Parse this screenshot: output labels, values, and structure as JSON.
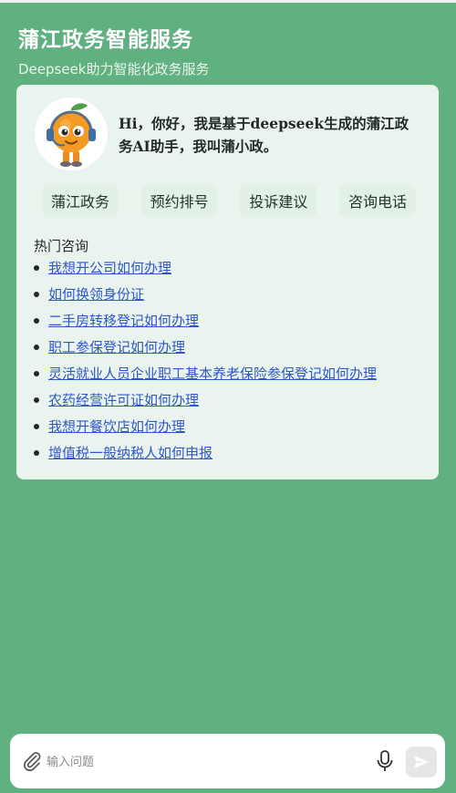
{
  "app": {
    "title": "蒲江政务智能服务",
    "subtitle": "Deepseek助力智能化政务服务"
  },
  "assistant": {
    "greeting": "Hi，你好，我是基于deepseek生成的蒲江政务AI助手，我叫蒲小政。",
    "avatar_icon": "orange-robot-mascot"
  },
  "quick_actions": [
    {
      "label": "蒲江政务"
    },
    {
      "label": "预约排号"
    },
    {
      "label": "投诉建议"
    },
    {
      "label": "咨询电话"
    }
  ],
  "hot_questions": {
    "title": "热门咨询",
    "items": [
      "我想开公司如何办理",
      "如何换领身份证",
      "二手房转移登记如何办理",
      "职工参保登记如何办理",
      "灵活就业人员企业职工基本养老保险参保登记如何办理",
      "农药经营许可证如何办理",
      "我想开餐饮店如何办理",
      "增值税一般纳税人如何申报"
    ]
  },
  "input": {
    "placeholder": "输入问题",
    "attach_icon": "paperclip-icon",
    "mic_icon": "microphone-icon",
    "send_icon": "send-icon"
  },
  "colors": {
    "background": "#61b07f",
    "card": "#eaf4ef",
    "link": "#2f57c8"
  }
}
